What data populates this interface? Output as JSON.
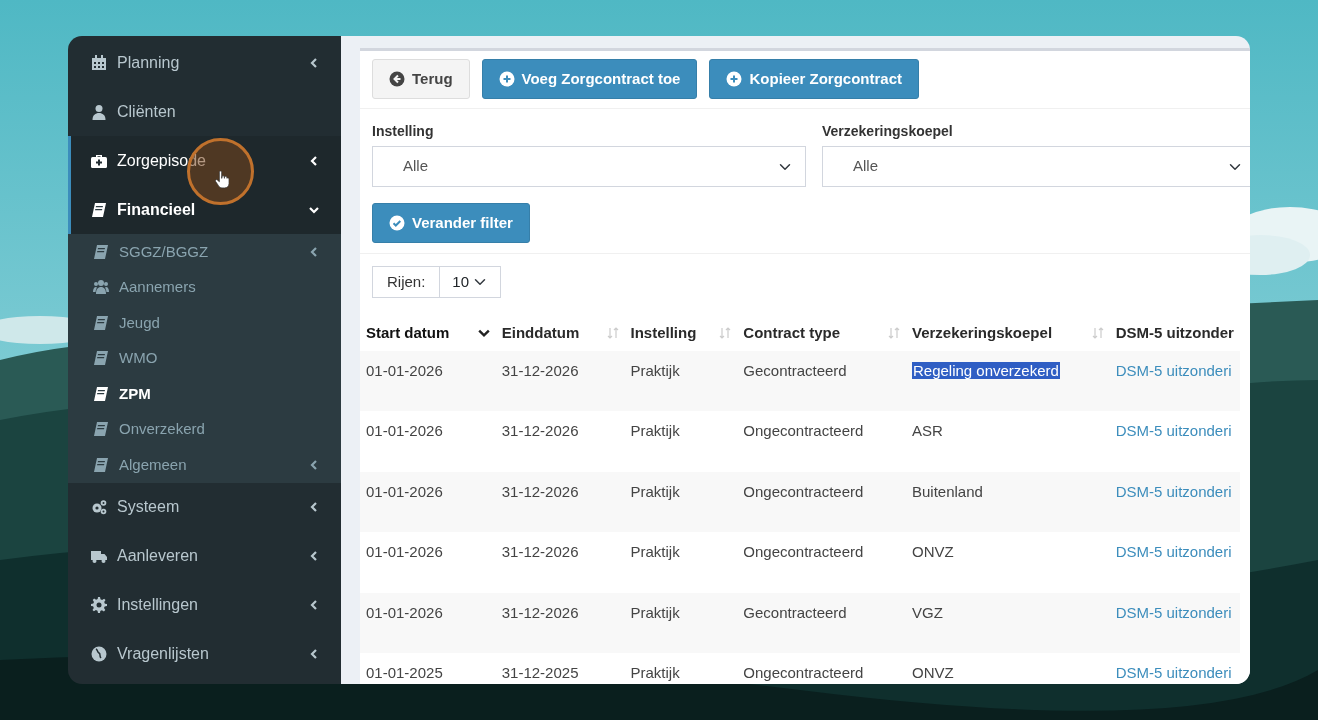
{
  "sidebar": {
    "items": [
      {
        "label": "Planning",
        "kind": "group",
        "expanded": false,
        "active": false
      },
      {
        "label": "Cliënten",
        "kind": "link",
        "active": false
      },
      {
        "label": "Zorgepisode",
        "kind": "group",
        "expanded": false,
        "active": true
      },
      {
        "label": "Financieel",
        "kind": "group",
        "expanded": true,
        "active": true,
        "children": [
          {
            "label": "SGGZ/BGGZ",
            "kind": "group",
            "selected": false
          },
          {
            "label": "Aannemers",
            "kind": "link",
            "selected": false
          },
          {
            "label": "Jeugd",
            "kind": "link",
            "selected": false
          },
          {
            "label": "WMO",
            "kind": "link",
            "selected": false
          },
          {
            "label": "ZPM",
            "kind": "link",
            "selected": true
          },
          {
            "label": "Onverzekerd",
            "kind": "link",
            "selected": false
          },
          {
            "label": "Algemeen",
            "kind": "group",
            "selected": false
          }
        ]
      },
      {
        "label": "Systeem",
        "kind": "group",
        "expanded": false,
        "active": false
      },
      {
        "label": "Aanleveren",
        "kind": "group",
        "expanded": false,
        "active": false
      },
      {
        "label": "Instellingen",
        "kind": "group",
        "expanded": false,
        "active": false
      },
      {
        "label": "Vragenlijsten",
        "kind": "group",
        "expanded": false,
        "active": false
      }
    ]
  },
  "toolbar": {
    "buttons": [
      {
        "label": "Terug",
        "kind": "back"
      },
      {
        "label": "Voeg Zorgcontract toe",
        "kind": "add"
      },
      {
        "label": "Kopieer Zorgcontract",
        "kind": "add"
      }
    ]
  },
  "filters": [
    {
      "label": "Instelling",
      "value": "Alle"
    },
    {
      "label": "Verzekeringskoepel",
      "value": "Alle"
    }
  ],
  "filter_button": {
    "label": "Verander filter"
  },
  "page_size": {
    "label": "Rijen:",
    "value": "10"
  },
  "table": {
    "columns": [
      {
        "label": "Start datum",
        "sortable": true,
        "sorted": true
      },
      {
        "label": "Einddatum",
        "sortable": true,
        "sorted": false
      },
      {
        "label": "Instelling",
        "sortable": true,
        "sorted": false
      },
      {
        "label": "Contract type",
        "sortable": true,
        "sorted": false
      },
      {
        "label": "Verzekeringskoepel",
        "sortable": true,
        "sorted": false
      },
      {
        "label": "DSM-5 uitzonder",
        "sortable": false,
        "sorted": false
      }
    ],
    "rows": [
      {
        "cells": [
          "01-01-2026",
          "31-12-2026",
          "Praktijk",
          "Gecontracteerd",
          "Regeling onverzekerd",
          "DSM-5 uitzonderi"
        ],
        "koepel_selected": true
      },
      {
        "cells": [
          "01-01-2026",
          "31-12-2026",
          "Praktijk",
          "Ongecontracteerd",
          "ASR",
          "DSM-5 uitzonderi"
        ],
        "koepel_selected": false
      },
      {
        "cells": [
          "01-01-2026",
          "31-12-2026",
          "Praktijk",
          "Ongecontracteerd",
          "Buitenland",
          "DSM-5 uitzonderi"
        ],
        "koepel_selected": false
      },
      {
        "cells": [
          "01-01-2026",
          "31-12-2026",
          "Praktijk",
          "Ongecontracteerd",
          "ONVZ",
          "DSM-5 uitzonderi"
        ],
        "koepel_selected": false
      },
      {
        "cells": [
          "01-01-2026",
          "31-12-2026",
          "Praktijk",
          "Gecontracteerd",
          "VGZ",
          "DSM-5 uitzonderi"
        ],
        "koepel_selected": false
      },
      {
        "cells": [
          "01-01-2025",
          "31-12-2025",
          "Praktijk",
          "Ongecontracteerd",
          "ONVZ",
          "DSM-5 uitzonderi"
        ],
        "koepel_selected": false
      }
    ]
  }
}
